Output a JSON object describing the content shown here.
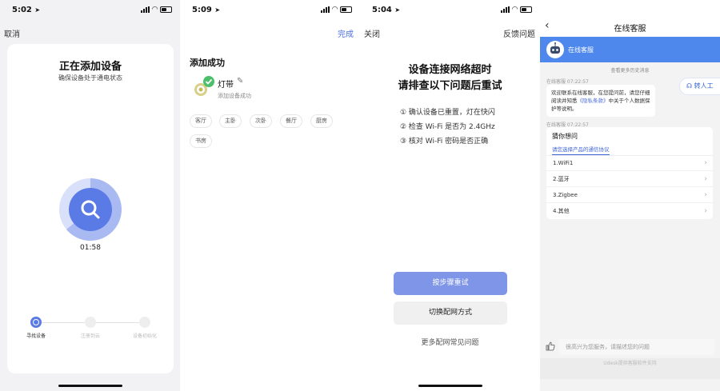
{
  "panel1": {
    "time": "5:02",
    "cancel_label": "取消",
    "title": "正在添加设备",
    "subtitle": "确保设备处于通电状态",
    "timer": "01:58",
    "steps": [
      "寻找设备",
      "注册到云",
      "设备初始化"
    ],
    "accent": "#5a7be6"
  },
  "panel2": {
    "time": "5:09",
    "done_label": "完成",
    "heading": "添加成功",
    "device_name": "灯带",
    "device_status": "添加设备成功",
    "rooms": [
      "客厅",
      "主卧",
      "次卧",
      "餐厅",
      "厨房",
      "书房"
    ]
  },
  "panel3": {
    "time": "5:04",
    "close_label": "关闭",
    "feedback_label": "反馈问题",
    "title_line1": "设备连接网络超时",
    "title_line2": "请排查以下问题后重试",
    "tips": [
      "① 确认设备已重置，灯在快闪",
      "② 检查 Wi-Fi 是否为 2.4GHz",
      "③ 核对 Wi-Fi 密码是否正确"
    ],
    "retry_label": "按步骤重试",
    "switch_label": "切换配网方式",
    "faq_label": "更多配网常见问题"
  },
  "panel4": {
    "title": "在线客服",
    "agent_name": "在线客服",
    "history_label": "查看更多历史消息",
    "msg1_meta": "在线客服  07:22:57",
    "msg1_a": "欢迎联系在线客服，在您提问前，请您仔细阅读并知悉",
    "msg1_link": "《隐私条款》",
    "msg1_b": "中关于个人数据保护等说明。",
    "transfer_label": "转人工",
    "msg2_meta": "在线客服  07:22:57",
    "guess_title": "猜你想问",
    "guess_sub": "请您选择产品的通信协议",
    "options": [
      "1.WiFi1",
      "2.蓝牙",
      "3.Zigbee",
      "4.其他"
    ],
    "input_placeholder": "很高兴为您服务，请描述您的问题",
    "footer": "Udesk提供客服软件支持",
    "accent": "#4e88ec"
  }
}
